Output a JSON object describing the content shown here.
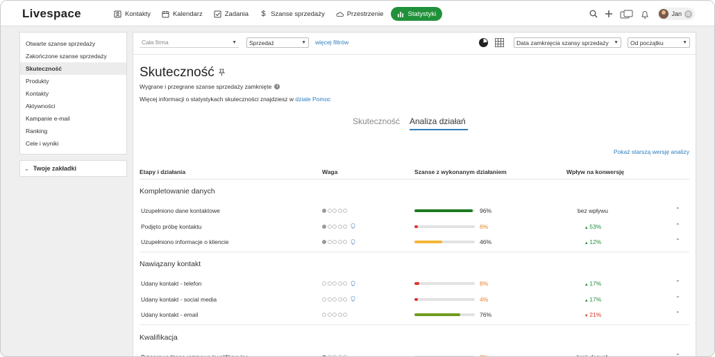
{
  "app": {
    "logo": "Livespace",
    "nav": [
      {
        "label": "Kontakty",
        "icon": "contacts-icon"
      },
      {
        "label": "Kalendarz",
        "icon": "calendar-icon"
      },
      {
        "label": "Zadania",
        "icon": "tasks-icon"
      },
      {
        "label": "Szanse sprzedaży",
        "icon": "dollar-icon"
      },
      {
        "label": "Przestrzenie",
        "icon": "cloud-icon"
      },
      {
        "label": "Statystyki",
        "icon": "bar-chart-icon",
        "active": true
      }
    ],
    "user": {
      "name": "Jan"
    },
    "accent": "#20913a",
    "link_color": "#2d7dbd"
  },
  "sidebar": {
    "items": [
      {
        "label": "Otwarte szanse sprzedaży"
      },
      {
        "label": "Zakończone szanse sprzedaży"
      },
      {
        "label": "Skuteczność",
        "active": true
      },
      {
        "label": "Produkty"
      },
      {
        "label": "Kontakty"
      },
      {
        "label": "Aktywności"
      },
      {
        "label": "Kampanie e-mail"
      },
      {
        "label": "Ranking"
      },
      {
        "label": "Cele i wyniki"
      }
    ],
    "bookmarks_label": "Twoje zakładki"
  },
  "filters": {
    "company_placeholder": "Cała firma",
    "pipeline": "Sprzedaż",
    "more_filters": "więcej filtrów",
    "date_field": "Data zamknięcia szansy sprzedaży",
    "period": "Od początku"
  },
  "page": {
    "title": "Skuteczność",
    "subtitle": "Wygrane i przegrane szanse sprzedaży zamknięte",
    "more_info_text": "Więcej informacji o statystykach skuteczności znajdziesz w",
    "more_info_link": "dziale Pomoc",
    "tabs": [
      "Skuteczność",
      "Analiza działań"
    ],
    "older_version": "Pokaż starszą wersję analizy"
  },
  "table": {
    "headers": [
      "Etapy i działania",
      "Waga",
      "Szanse z wykonanym działaniem",
      "Wpływ na konwersję"
    ],
    "sections": [
      {
        "title": "Kompletowanie danych",
        "rows": [
          {
            "label": "Uzupełniono dane kontaktowe",
            "weight": 1,
            "bulb": false,
            "value": 96,
            "pct": "96%",
            "bar_color": "#1a7a1e",
            "pct_color": "#333333",
            "impact": "bez wpływu",
            "dir": "neutral"
          },
          {
            "label": "Podjęto próbę kontaktu",
            "weight": 1,
            "bulb": true,
            "value": 6,
            "pct": "6%",
            "bar_color": "#d9352b",
            "pct_color": "#e0822b",
            "impact": "53%",
            "dir": "up"
          },
          {
            "label": "Uzupełniono informacje o kliencie",
            "weight": 1,
            "bulb": true,
            "value": 46,
            "pct": "46%",
            "bar_color": "#f3b536",
            "pct_color": "#333333",
            "impact": "12%",
            "dir": "up"
          }
        ]
      },
      {
        "title": "Nawiązany kontakt",
        "rows": [
          {
            "label": "Udany kontakt - telefon",
            "weight": 0,
            "bulb": true,
            "value": 8,
            "pct": "8%",
            "bar_color": "#d9352b",
            "pct_color": "#e0822b",
            "impact": "17%",
            "dir": "up"
          },
          {
            "label": "Udany kontakt - social media",
            "weight": 0,
            "bulb": true,
            "value": 4,
            "pct": "4%",
            "bar_color": "#d9352b",
            "pct_color": "#e0822b",
            "impact": "17%",
            "dir": "up"
          },
          {
            "label": "Udany kontakt - email",
            "weight": 0,
            "bulb": false,
            "value": 76,
            "pct": "76%",
            "bar_color": "#6e9a1f",
            "pct_color": "#333333",
            "impact": "21%",
            "dir": "down"
          }
        ]
      },
      {
        "title": "Kwalifikacja",
        "rows": [
          {
            "label": "Przeprowadzona rozmowa kwalifikacyjna",
            "weight": 1,
            "bulb": false,
            "value": 0,
            "pct": "0%",
            "bar_color": "#d9352b",
            "pct_color": "#e0822b",
            "impact": "brak danych",
            "dir": "neutral"
          }
        ]
      }
    ]
  }
}
